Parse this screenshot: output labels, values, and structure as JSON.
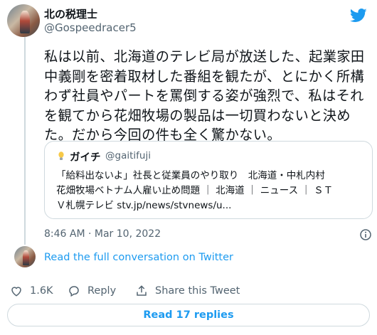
{
  "author": {
    "name": "北の税理士",
    "handle": "@Gospeedracer5"
  },
  "tweet": {
    "text": "私は以前、北海道のテレビ局が放送した、起業家田\n中義剛を密着取材した番組を観たが、とにかく所構\nわず社員やパートを罵倒する姿が強烈で、私はそれ\nを観てから花畑牧場の製品は一切買わないと決め\nた。だから今回の件も全く驚かない。",
    "timestamp": "8:46 AM · Mar 10, 2022"
  },
  "quote": {
    "name": "ガイチ",
    "handle": "@gaitifuji",
    "text": "「給料出ないよ」社長と従業員のやり取り　北海道・中札内村\n花畑牧場ベトナム人雇い止め問題 ｜ 北海道 ｜ ニュース ｜ ＳＴ\nＶ札幌テレビ stv.jp/news/stvnews/u..."
  },
  "links": {
    "read_conversation": "Read the full conversation on Twitter"
  },
  "actions": {
    "like_count": "1.6K",
    "reply_label": "Reply",
    "share_label": "Share this Tweet"
  },
  "replies_button": "Read 17 replies",
  "colors": {
    "accent": "#1d9bf0",
    "like": "#f91880",
    "secondary_text": "#536471",
    "border": "#cfd9de"
  },
  "icons": [
    "twitter-bird-icon",
    "lightbulb-icon",
    "info-icon",
    "heart-icon",
    "reply-icon",
    "share-icon"
  ]
}
